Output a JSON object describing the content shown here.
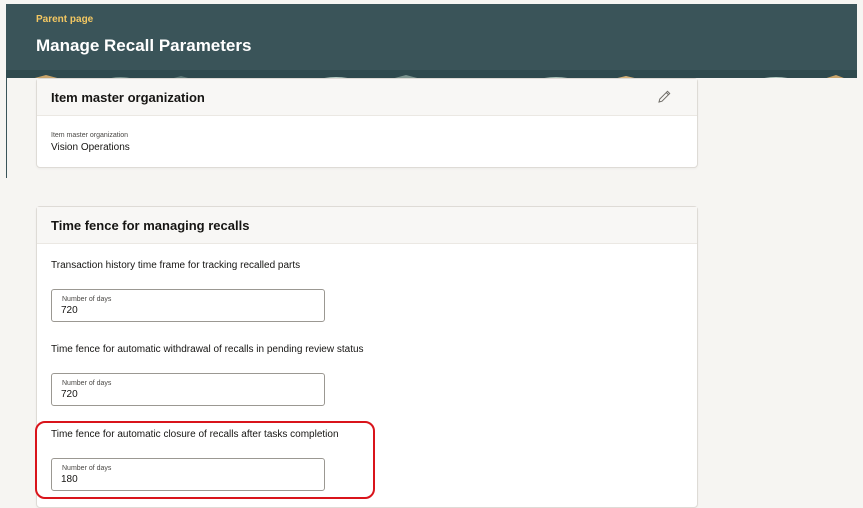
{
  "header": {
    "parent_link": "Parent page",
    "title": "Manage Recall Parameters"
  },
  "item_master": {
    "section_title": "Item master organization",
    "edit_icon": "pencil-icon",
    "field_label": "Item master organization",
    "field_value": "Vision Operations"
  },
  "time_fence": {
    "section_title": "Time fence for managing recalls",
    "fields": [
      {
        "description": "Transaction history time frame for tracking recalled parts",
        "label": "Number of days",
        "value": "720"
      },
      {
        "description": "Time fence for automatic withdrawal of recalls in pending review status",
        "label": "Number of days",
        "value": "720"
      },
      {
        "description": "Time fence for automatic closure of recalls after tasks completion",
        "label": "Number of days",
        "value": "180"
      }
    ]
  },
  "colors": {
    "header_bg": "#3a5459",
    "parent_link": "#f3c762",
    "highlight": "#d9141b"
  }
}
